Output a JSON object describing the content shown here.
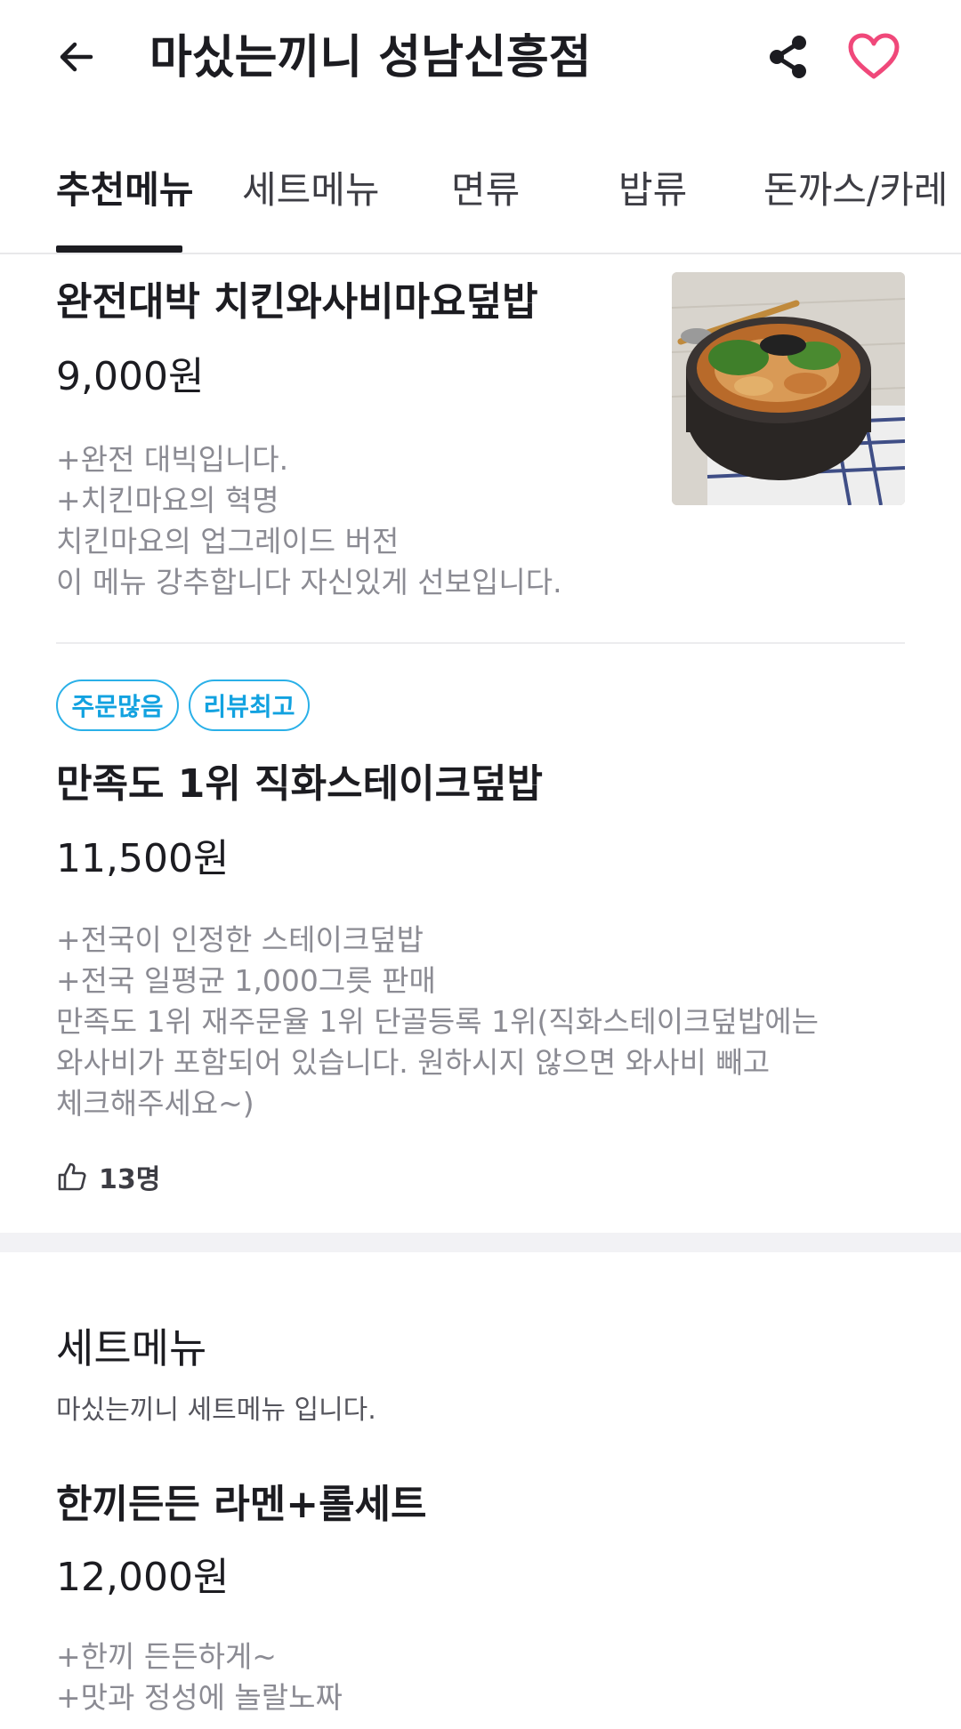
{
  "header": {
    "title": "마싰는끼니 성남신흥점",
    "icons": [
      "back-arrow-icon",
      "share-icon",
      "heart-icon"
    ],
    "heart_color": "#f0487a"
  },
  "tabs": [
    {
      "label": "추천메뉴",
      "active": true
    },
    {
      "label": "세트메뉴"
    },
    {
      "label": "면류"
    },
    {
      "label": "밥류"
    },
    {
      "label": "돈까스/카레"
    }
  ],
  "recommended": [
    {
      "name": "완전대박 치킨와사비마요덮밥",
      "price": "9,000원",
      "description": [
        "+완전 대빅입니다.",
        "+치킨마요의 혁명",
        "치킨마요의 업그레이드 버전",
        "이 메뉴 강추합니다 자신있게 선보입니다."
      ]
    },
    {
      "badges": [
        "주문많음",
        "리뷰최고"
      ],
      "name": "만족도 1위 직화스테이크덮밥",
      "price": "11,500원",
      "description": [
        "+전국이 인정한 스테이크덮밥",
        "+전국 일평균 1,000그릇 판매",
        "만족도 1위 재주문율 1위 단골등록 1위(직화스테이크덮밥에는",
        "와사비가 포함되어 있습니다. 원하시지 않으면 와사비 빼고",
        "체크해주세요~)"
      ],
      "likes": "13명"
    }
  ],
  "set_section": {
    "title": "세트메뉴",
    "subtitle": "마싰는끼니 세트메뉴 입니다.",
    "items": [
      {
        "name": "한끼든든 라멘+롤세트",
        "price": "12,000원",
        "description": [
          "+한끼 든든하게~",
          "+맛과 정성에 놀랄노짜"
        ]
      }
    ]
  },
  "colors": {
    "badge": "#12a2e0",
    "text_primary": "#1c1c21",
    "text_secondary": "#8b8b93"
  }
}
